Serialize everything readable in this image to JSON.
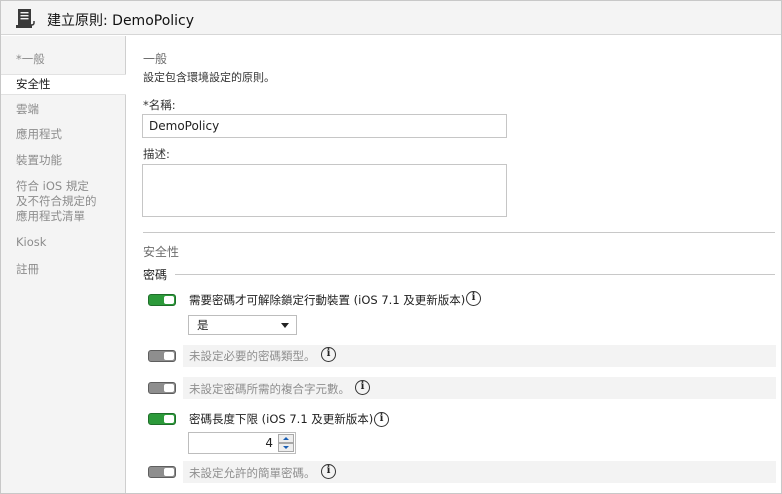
{
  "window": {
    "title": "建立原則: DemoPolicy",
    "icon": "document-scroll-icon"
  },
  "sidebar": {
    "items": [
      {
        "label": "*一般"
      },
      {
        "label": "安全性"
      },
      {
        "label": "雲端"
      },
      {
        "label": "應用程式"
      },
      {
        "label": "裝置功能"
      },
      {
        "label_lines": [
          "符合 iOS 規定",
          "及不符合規定的",
          "應用程式清單"
        ]
      },
      {
        "label": "Kiosk"
      },
      {
        "label": "註冊"
      }
    ],
    "active_index": 1
  },
  "general": {
    "heading": "一般",
    "description": "設定包含環境設定的原則。",
    "name_label": "*名稱:",
    "name_value": "DemoPolicy",
    "desc_label": "描述:",
    "desc_value": ""
  },
  "security": {
    "heading": "安全性",
    "group_title": "密碼",
    "settings": [
      {
        "text": "需要密碼才可解除鎖定行動裝置 (iOS 7.1 及更新版本)",
        "enabled": true
      },
      {
        "text": "未設定必要的密碼類型。",
        "enabled": false
      },
      {
        "text": "未設定密碼所需的複合字元數。",
        "enabled": false
      },
      {
        "text": "密碼長度下限 (iOS 7.1 及更新版本)",
        "enabled": true
      },
      {
        "text": "未設定允許的簡單密碼。",
        "enabled": false
      }
    ],
    "unlock_select_value": "是",
    "min_length_value": "4",
    "info_glyph": "i"
  },
  "colors": {
    "toggle_on": "#2c9a3a",
    "toggle_off": "#8e8e8e",
    "sidebar_bg": "#f4f4f4"
  }
}
